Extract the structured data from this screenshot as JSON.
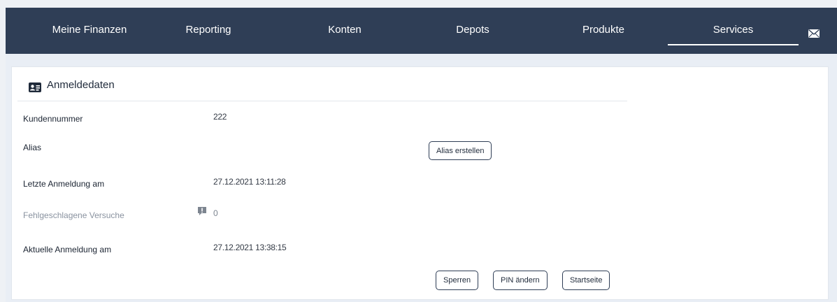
{
  "nav": {
    "items": [
      {
        "label": "Meine Finanzen"
      },
      {
        "label": "Reporting"
      },
      {
        "label": "Konten"
      },
      {
        "label": "Depots"
      },
      {
        "label": "Produkte"
      },
      {
        "label": "Services",
        "active": true
      }
    ],
    "mail_icon": "envelope-icon"
  },
  "card": {
    "title": "Anmeldedaten",
    "icon": "id-card-icon",
    "rows": {
      "kundennummer": {
        "label": "Kundennummer",
        "value": "222"
      },
      "alias": {
        "label": "Alias",
        "button": "Alias erstellen"
      },
      "letzte": {
        "label": "Letzte Anmeldung am",
        "value": "27.12.2021 13:11:28"
      },
      "fehl": {
        "label": "Fehlgeschlagene Versuche",
        "value": "0",
        "icon": "warning-icon"
      },
      "aktuelle": {
        "label": "Aktuelle Anmeldung am",
        "value": "27.12.2021 13:38:15"
      }
    },
    "actions": {
      "sperren": "Sperren",
      "pin": "PIN ändern",
      "start": "Startseite"
    }
  },
  "colors": {
    "nav_bg": "#2f3e56",
    "page_bg": "#e9eef5",
    "card_bg": "#ffffff",
    "button_border": "#2f3e56"
  }
}
